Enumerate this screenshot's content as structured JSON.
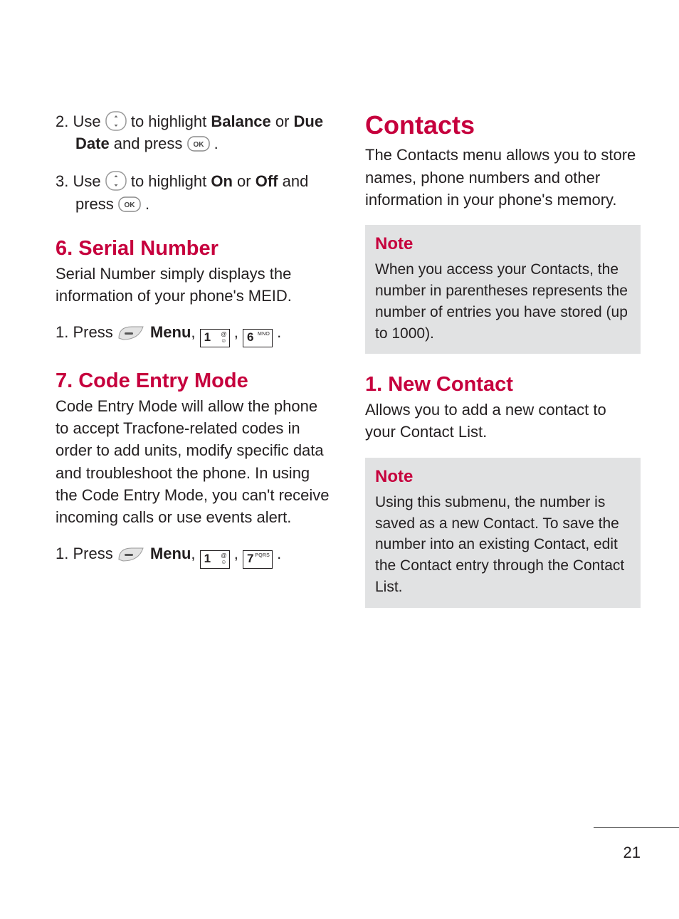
{
  "left": {
    "step2": {
      "num": "2.",
      "t1": " Use ",
      "t2": " to highlight ",
      "b1": "Balance",
      "t3": " or ",
      "b2": "Due Date",
      "t4": " and press ",
      "t5": " ."
    },
    "step3": {
      "num": "3.",
      "t1": " Use ",
      "t2": " to highlight ",
      "b1": "On",
      "t3": " or ",
      "b2": "Off",
      "t4": " and press ",
      "t5": " ."
    },
    "sec6": {
      "heading": "6. Serial Number",
      "body": "Serial Number simply displays the information of your phone's MEID.",
      "step1": {
        "num": "1.",
        "t1": " Press ",
        "menu": "Menu",
        "c1": ", ",
        "c2": " , ",
        "c3": " ."
      }
    },
    "sec7": {
      "heading": "7. Code Entry Mode",
      "body": "Code Entry Mode will allow the phone to accept Tracfone-related codes in order to add units, modify specific data and troubleshoot the phone. In using the Code Entry Mode, you can't receive incoming calls or use events alert.",
      "step1": {
        "num": "1.",
        "t1": " Press ",
        "menu": "Menu",
        "c1": ", ",
        "c2": " , ",
        "c3": " ."
      }
    }
  },
  "right": {
    "title": "Contacts",
    "intro": "The Contacts menu allows you to store names, phone numbers and other information in your phone's memory.",
    "note1": {
      "label": "Note",
      "body": "When you access your Contacts, the number in parentheses represents the number of entries you have stored (up to 1000)."
    },
    "sec1": {
      "heading": "1. New Contact",
      "body": "Allows you to add a new contact to your Contact List."
    },
    "note2": {
      "label": "Note",
      "body": "Using this submenu, the number is saved as a new Contact. To save the number into an existing Contact, edit the Contact entry through the Contact List."
    }
  },
  "keys": {
    "k1_main": "1",
    "k6_main": "6",
    "k6_sub": "MNO",
    "k7_main": "7",
    "k7_sub": "PQRS"
  },
  "page_number": "21"
}
